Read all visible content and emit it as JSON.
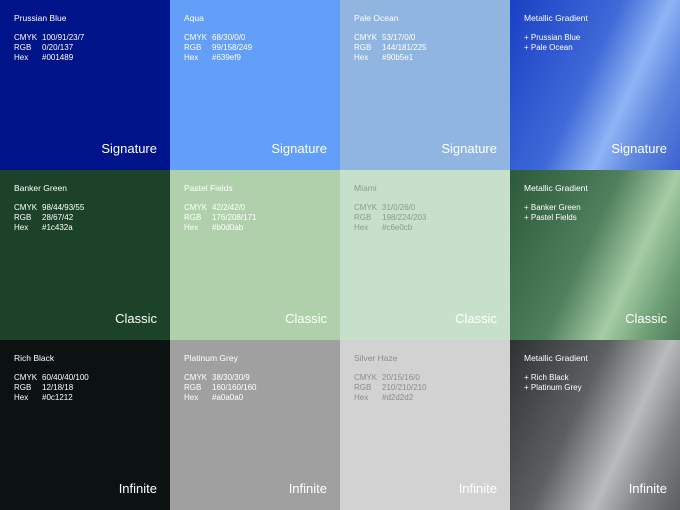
{
  "rows": [
    {
      "label": "Signature",
      "swatches": [
        {
          "name": "Prussian Blue",
          "cmyk": "100/91/23/7",
          "rgb": "0/20/137",
          "hex": "#001489",
          "color": "#001489"
        },
        {
          "name": "Aqua",
          "cmyk": "68/30/0/0",
          "rgb": "99/158/249",
          "hex": "#639ef9",
          "color": "#639ef9"
        },
        {
          "name": "Pale Ocean",
          "cmyk": "53/17/0/0",
          "rgb": "144/181/225",
          "hex": "#90b5e1",
          "color": "#90b5e1"
        }
      ],
      "gradient": {
        "name": "Metallic Gradient",
        "mix": [
          "+ Prussian Blue",
          "+ Pale Ocean"
        ]
      }
    },
    {
      "label": "Classic",
      "swatches": [
        {
          "name": "Banker Green",
          "cmyk": "98/44/93/55",
          "rgb": "28/67/42",
          "hex": "#1c432a",
          "color": "#1c432a"
        },
        {
          "name": "Pastel Fields",
          "cmyk": "42/2/42/0",
          "rgb": "176/208/171",
          "hex": "#b0d0ab",
          "color": "#b0d0ab"
        },
        {
          "name": "Miami",
          "cmyk": "31/0/26/0",
          "rgb": "198/224/203",
          "hex": "#c6e0cb",
          "color": "#c6e0cb"
        }
      ],
      "gradient": {
        "name": "Metallic Gradient",
        "mix": [
          "+ Banker Green",
          "+ Pastel Fields"
        ]
      }
    },
    {
      "label": "Infinite",
      "swatches": [
        {
          "name": "Rich Black",
          "cmyk": "60/40/40/100",
          "rgb": "12/18/18",
          "hex": "#0c1212",
          "color": "#0c1212"
        },
        {
          "name": "Platinum Grey",
          "cmyk": "38/30/30/9",
          "rgb": "160/160/160",
          "hex": "#a0a0a0",
          "color": "#a0a0a0"
        },
        {
          "name": "Silver Haze",
          "cmyk": "20/15/16/0",
          "rgb": "210/210/210",
          "hex": "#d2d2d2",
          "color": "#d2d2d2"
        }
      ],
      "gradient": {
        "name": "Metallic Gradient",
        "mix": [
          "+ Rich Black",
          "+ Platinum Grey"
        ]
      }
    }
  ],
  "spec_keys": {
    "cmyk": "CMYK",
    "rgb": "RGB",
    "hex": "Hex"
  }
}
